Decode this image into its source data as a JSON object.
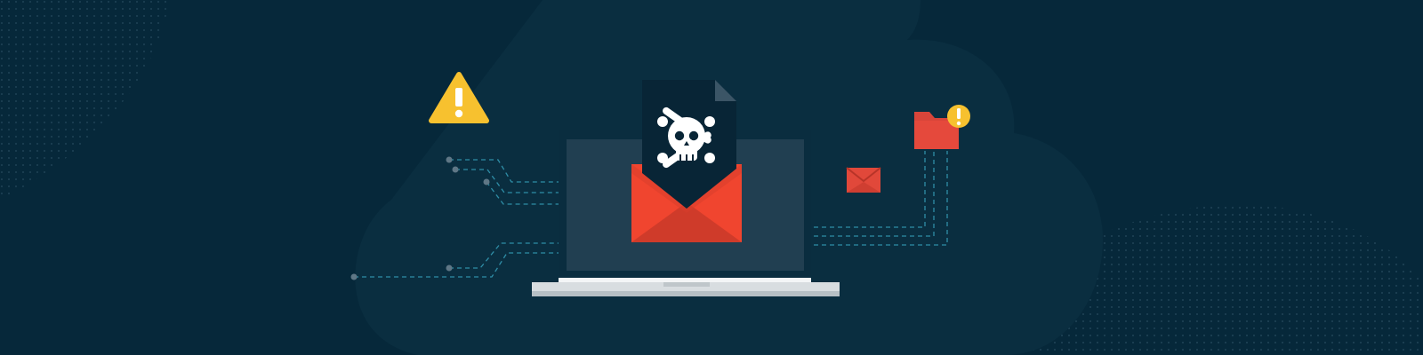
{
  "scene": {
    "illustration": "phishing-email-malware-banner",
    "colors": {
      "background": "#06283a",
      "cloud": "#0a2e40",
      "laptop_frame": "#0a2d3f",
      "laptop_screen": "#213f51",
      "laptop_base": "#d8dde0",
      "envelope": "#f0452f",
      "envelope_dark": "#cf3b2a",
      "document": "#082536",
      "document_fold": "#3b5566",
      "skull": "#ffffff",
      "warning": "#f7c12f",
      "connector": "#2f8ea7",
      "folder": "#d9453a"
    },
    "icons": [
      "warning-triangle-icon",
      "laptop-icon",
      "envelope-icon",
      "skull-crossbones-icon",
      "small-envelope-icon",
      "folder-icon",
      "alert-badge-icon"
    ]
  }
}
